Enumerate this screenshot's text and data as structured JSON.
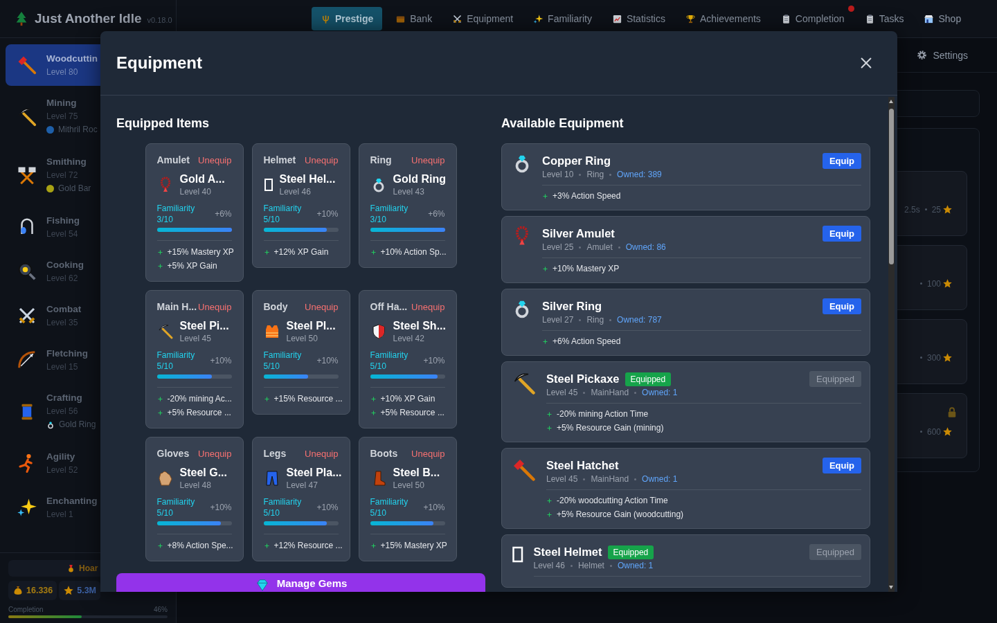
{
  "app": {
    "title": "Just Another Idle",
    "version": "v0.18.0"
  },
  "nav": {
    "tabs": [
      {
        "label": "Prestige",
        "selected": true,
        "badge": false
      },
      {
        "label": "Bank",
        "selected": false,
        "badge": false
      },
      {
        "label": "Equipment",
        "selected": false,
        "badge": false
      },
      {
        "label": "Familiarity",
        "selected": false,
        "badge": false
      },
      {
        "label": "Statistics",
        "selected": false,
        "badge": false
      },
      {
        "label": "Achievements",
        "selected": false,
        "badge": false
      },
      {
        "label": "Completion",
        "selected": false,
        "badge": true
      },
      {
        "label": "Tasks",
        "selected": false,
        "badge": false
      },
      {
        "label": "Shop",
        "selected": false,
        "badge": false
      }
    ],
    "settings": {
      "label": "Settings"
    }
  },
  "sidebar": {
    "skills": [
      {
        "name": "Woodcuttin",
        "level_label": "Level 80",
        "selected": true
      },
      {
        "name": "Mining",
        "level_label": "Level 75",
        "selected": false,
        "sub": {
          "kind": "dot",
          "color": "#1e5fa8",
          "text": "Mithril Roc"
        }
      },
      {
        "name": "Smithing",
        "level_label": "Level 72",
        "selected": false,
        "sub": {
          "kind": "dot",
          "color": "#a8a214",
          "text": "Gold Bar"
        }
      },
      {
        "name": "Fishing",
        "level_label": "Level 54",
        "selected": false
      },
      {
        "name": "Cooking",
        "level_label": "Level 62",
        "selected": false
      },
      {
        "name": "Combat",
        "level_label": "Level 35",
        "selected": false
      },
      {
        "name": "Fletching",
        "level_label": "Level 15",
        "selected": false
      },
      {
        "name": "Crafting",
        "level_label": "Level 56",
        "selected": false,
        "sub": {
          "kind": "ring",
          "text": "Gold Ring"
        }
      },
      {
        "name": "Agility",
        "level_label": "Level 52",
        "selected": false
      },
      {
        "name": "Enchanting",
        "level_label": "Level 1",
        "selected": false
      }
    ],
    "hoard": "Hoar",
    "gold": "16.336",
    "stars": "5.3M",
    "completion": {
      "label": "Completion",
      "value": "46%",
      "level": 0.46
    }
  },
  "background": {
    "cards": [
      {
        "time": "2.5s",
        "cost": "25",
        "locked": false
      },
      {
        "cost": "100",
        "locked": false
      },
      {
        "cost": "300",
        "locked": false
      },
      {
        "cost": "600",
        "locked": true
      }
    ]
  },
  "modal": {
    "title": "Equipment",
    "equipped_title": "Equipped Items",
    "available_title": "Available Equipment",
    "gems_button": "Manage Gems",
    "slots": [
      {
        "slot": "Amulet",
        "action": "Unequip",
        "name": "Gold A...",
        "item_level": "Level 40",
        "kind": "amulet",
        "familiarity": "Familiarity 3/10",
        "bonus": "+6%",
        "level": 1.0,
        "effects": [
          "+15% Mastery XP",
          "+5% XP Gain"
        ]
      },
      {
        "slot": "Helmet",
        "action": "Unequip",
        "name": "Steel Hel...",
        "item_level": "Level 46",
        "kind": "box",
        "familiarity": "Familiarity 5/10",
        "bonus": "+10%",
        "level": 0.85,
        "effects": [
          "+12% XP Gain"
        ]
      },
      {
        "slot": "Ring",
        "action": "Unequip",
        "name": "Gold Ring",
        "item_level": "Level 43",
        "kind": "ring",
        "familiarity": "Familiarity 3/10",
        "bonus": "+6%",
        "level": 1.0,
        "effects": [
          "+10% Action Sp..."
        ]
      },
      {
        "slot": "Main H...",
        "action": "Unequip",
        "name": "Steel Pi...",
        "item_level": "Level 45",
        "kind": "pickaxe",
        "familiarity": "Familiarity 5/10",
        "bonus": "+10%",
        "level": 0.74,
        "effects": [
          "-20% mining Ac...",
          "+5% Resource ..."
        ]
      },
      {
        "slot": "Body",
        "action": "Unequip",
        "name": "Steel Pl...",
        "item_level": "Level 50",
        "kind": "vest",
        "familiarity": "Familiarity 5/10",
        "bonus": "+10%",
        "level": 0.6,
        "effects": [
          "+15% Resource ..."
        ]
      },
      {
        "slot": "Off Ha...",
        "action": "Unequip",
        "name": "Steel Sh...",
        "item_level": "Level 42",
        "kind": "shield",
        "familiarity": "Familiarity 5/10",
        "bonus": "+10%",
        "level": 0.9,
        "effects": [
          "+10% XP Gain",
          "+5% Resource ..."
        ]
      },
      {
        "slot": "Gloves",
        "action": "Unequip",
        "name": "Steel G...",
        "item_level": "Level 48",
        "kind": "glove",
        "familiarity": "Familiarity 5/10",
        "bonus": "+10%",
        "level": 0.86,
        "effects": [
          "+8% Action Spe..."
        ]
      },
      {
        "slot": "Legs",
        "action": "Unequip",
        "name": "Steel Pla...",
        "item_level": "Level 47",
        "kind": "pants",
        "familiarity": "Familiarity 5/10",
        "bonus": "+10%",
        "level": 0.85,
        "effects": [
          "+12% Resource ..."
        ]
      },
      {
        "slot": "Boots",
        "action": "Unequip",
        "name": "Steel B...",
        "item_level": "Level 50",
        "kind": "boot",
        "familiarity": "Familiarity 5/10",
        "bonus": "+10%",
        "level": 0.85,
        "effects": [
          "+15% Mastery XP"
        ]
      }
    ],
    "items": [
      {
        "name": "Copper Ring",
        "kind": "ring",
        "level_label": "Level 10",
        "slot": "Ring",
        "owned": "Owned: 389",
        "action": "Equip",
        "equipped": false,
        "effects": [
          "+3% Action Speed"
        ]
      },
      {
        "name": "Silver Amulet",
        "kind": "amulet",
        "level_label": "Level 25",
        "slot": "Amulet",
        "owned": "Owned: 86",
        "action": "Equip",
        "equipped": false,
        "effects": [
          "+10% Mastery XP"
        ]
      },
      {
        "name": "Silver Ring",
        "kind": "ring",
        "level_label": "Level 27",
        "slot": "Ring",
        "owned": "Owned: 787",
        "action": "Equip",
        "equipped": false,
        "effects": [
          "+6% Action Speed"
        ]
      },
      {
        "name": "Steel Pickaxe",
        "kind": "pickaxe",
        "badge": "Equipped",
        "level_label": "Level 45",
        "slot": "MainHand",
        "owned": "Owned: 1",
        "action": "Equipped",
        "equipped": true,
        "effects": [
          "-20% mining Action Time",
          "+5% Resource Gain (mining)"
        ]
      },
      {
        "name": "Steel Hatchet",
        "kind": "axe",
        "level_label": "Level 45",
        "slot": "MainHand",
        "owned": "Owned: 1",
        "action": "Equip",
        "equipped": false,
        "effects": [
          "-20% woodcutting Action Time",
          "+5% Resource Gain (woodcutting)"
        ]
      },
      {
        "name": "Steel Helmet",
        "kind": "box",
        "badge": "Equipped",
        "level_label": "Level 46",
        "slot": "Helmet",
        "owned": "Owned: 1",
        "action": "Equipped",
        "equipped": true
      }
    ]
  }
}
